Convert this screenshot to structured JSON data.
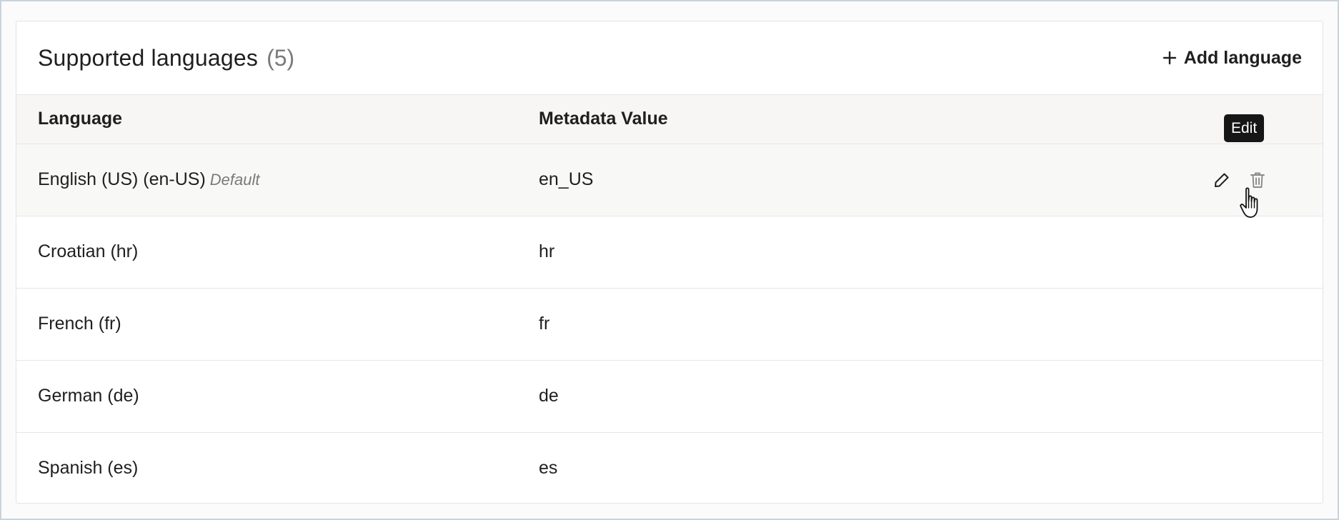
{
  "section": {
    "title": "Supported languages",
    "count": "(5)",
    "add_label": "Add language"
  },
  "table": {
    "columns": [
      "Language",
      "Metadata Value"
    ],
    "rows": [
      {
        "language": "English (US) (en-US)",
        "tag": "Default",
        "value": "en_US"
      },
      {
        "language": "Croatian (hr)",
        "tag": "",
        "value": "hr"
      },
      {
        "language": "French (fr)",
        "tag": "",
        "value": "fr"
      },
      {
        "language": "German (de)",
        "tag": "",
        "value": "de"
      },
      {
        "language": "Spanish (es)",
        "tag": "",
        "value": "es"
      }
    ]
  },
  "tooltip": {
    "text": "Edit"
  },
  "icons": {
    "add": "plus-icon",
    "edit": "pencil-icon",
    "delete": "trash-icon",
    "cursor": "hand-pointer-icon"
  }
}
